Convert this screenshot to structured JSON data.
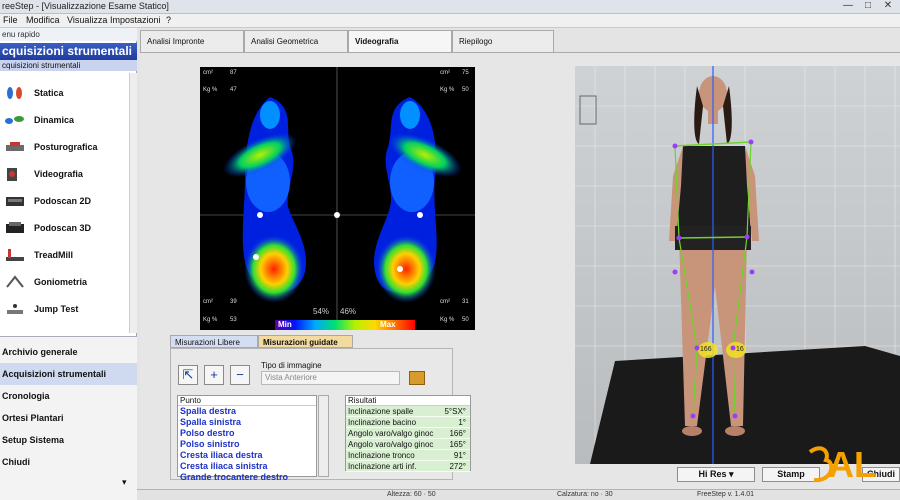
{
  "window": {
    "title": "reeStep - [Visualizzazione Esame Statico]",
    "controls": [
      "—",
      "□",
      "✕"
    ]
  },
  "menu": [
    "File",
    "Modifica",
    "Visualizza",
    "Impostazioni",
    "?"
  ],
  "sidebar": {
    "header": "enu rapido",
    "title": "cquisizioni strumentali",
    "subtitle": "cquisizioni strumentali",
    "items": [
      {
        "label": "Statica",
        "icon": "feet-icon"
      },
      {
        "label": "Dinamica",
        "icon": "walking-icon"
      },
      {
        "label": "Posturografica",
        "icon": "platform-icon"
      },
      {
        "label": "Videografia",
        "icon": "camera-icon"
      },
      {
        "label": "Podoscan 2D",
        "icon": "scanner-icon"
      },
      {
        "label": "Podoscan 3D",
        "icon": "scanner3d-icon"
      },
      {
        "label": "TreadMill",
        "icon": "treadmill-icon"
      },
      {
        "label": "Goniometria",
        "icon": "goniometer-icon"
      },
      {
        "label": "Jump Test",
        "icon": "jump-icon"
      }
    ],
    "nav": [
      {
        "label": "Archivio generale",
        "active": false
      },
      {
        "label": "Acquisizioni strumentali",
        "active": true
      },
      {
        "label": "Cronologia",
        "active": false
      },
      {
        "label": "Ortesi Plantari",
        "active": false
      },
      {
        "label": "Setup Sistema",
        "active": false
      },
      {
        "label": "Chiudi",
        "active": false
      }
    ],
    "scroll_arrow": "▾"
  },
  "tabs": [
    {
      "label": "Analisi Impronte",
      "active": false
    },
    {
      "label": "Analisi Geometrica",
      "active": false
    },
    {
      "label": "Videografia",
      "active": true
    },
    {
      "label": "Riepilogo",
      "active": false
    }
  ],
  "heatmap": {
    "corners": {
      "tl_unit": "cm²",
      "tl_val": "87",
      "tl_unit2": "Kg %",
      "tl_val2": "47",
      "tr_unit": "cm²",
      "tr_val": "75",
      "tr_unit2": "Kg %",
      "tr_val2": "50",
      "bl_unit": "cm²",
      "bl_val": "39",
      "bl_unit2": "Kg %",
      "bl_val2": "53",
      "br_unit": "cm²",
      "br_val": "31",
      "br_unit2": "Kg %",
      "br_val2": "50"
    },
    "left_percent": "54%",
    "right_percent": "46%",
    "scale_min": "Min",
    "scale_max": "Max"
  },
  "lower_tabs": [
    {
      "label": "Misurazioni Libere",
      "active": false
    },
    {
      "label": "Misurazioni guidate",
      "active": true
    }
  ],
  "tools": {
    "select": "⇱",
    "zoom_in": "+",
    "zoom_out": "−"
  },
  "image_type": {
    "label": "Tipo di immagine",
    "value": "Vista Anteriore",
    "lock": "🔒"
  },
  "points": {
    "header": "Punto",
    "rows": [
      "Spalla destra",
      "Spalla sinistra",
      "Polso destro",
      "Polso sinistro",
      "Cresta iliaca destra",
      "Cresta iliaca sinistra",
      "Grande trocantere destro"
    ]
  },
  "results": {
    "header": "Risultati",
    "rows": [
      {
        "label": "Inclinazione spalle",
        "value": "5°SX°"
      },
      {
        "label": "Inclinazione bacino",
        "value": "1°"
      },
      {
        "label": "Angolo varo/valgo ginoc",
        "value": "166°"
      },
      {
        "label": "Angolo varo/valgo ginoc",
        "value": "165°"
      },
      {
        "label": "Inclinazione tronco",
        "value": "91°"
      },
      {
        "label": "Inclinazione arti inf.",
        "value": "272°"
      }
    ]
  },
  "photo": {
    "knee_left_label": "166",
    "knee_right_label": "16"
  },
  "buttons": {
    "hi_res": "Hi Res",
    "stampa": "Stamp",
    "chiudi": "Chiudi"
  },
  "statusbar": {
    "left": "Altezza: 60 · 50",
    "mid": "Calzatura: no · 30",
    "right": "FreeStep v. 1.4.01"
  },
  "logo_text": "AL",
  "colors": {
    "sidebar_title": "#2a4ab4",
    "active_nav": "#cfd9f0",
    "list_text": "#1d33c5",
    "results_bg": "#d9efd2",
    "lock": "#d89b2a",
    "logo": "#f4a000"
  }
}
